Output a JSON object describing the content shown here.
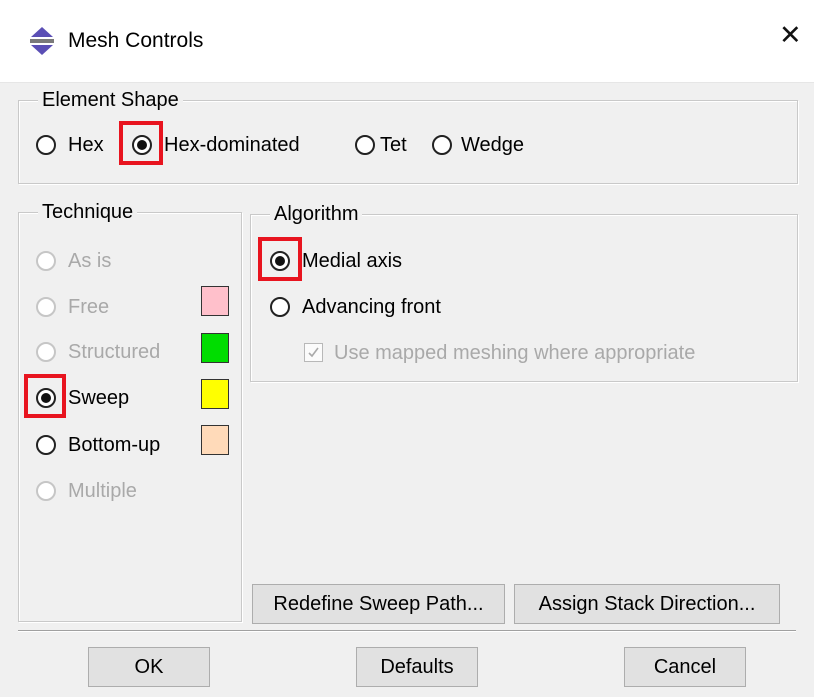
{
  "dialog": {
    "title": "Mesh Controls",
    "close_glyph": "✕",
    "app_icon": "abaqus-mesh-icon"
  },
  "element_shape": {
    "legend": "Element Shape",
    "options": [
      {
        "label": "Hex",
        "selected": false
      },
      {
        "label": "Hex-dominated",
        "selected": true
      },
      {
        "label": "Tet",
        "selected": false
      },
      {
        "label": "Wedge",
        "selected": false
      }
    ]
  },
  "technique": {
    "legend": "Technique",
    "options": [
      {
        "label": "As is",
        "selected": false,
        "enabled": false,
        "swatch": null
      },
      {
        "label": "Free",
        "selected": false,
        "enabled": false,
        "swatch": "#ffc0cb"
      },
      {
        "label": "Structured",
        "selected": false,
        "enabled": false,
        "swatch": "#00dd00"
      },
      {
        "label": "Sweep",
        "selected": true,
        "enabled": true,
        "swatch": "#ffff00"
      },
      {
        "label": "Bottom-up",
        "selected": false,
        "enabled": true,
        "swatch": "#ffdab9"
      },
      {
        "label": "Multiple",
        "selected": false,
        "enabled": false,
        "swatch": null
      }
    ]
  },
  "algorithm": {
    "legend": "Algorithm",
    "options": [
      {
        "label": "Medial axis",
        "selected": true
      },
      {
        "label": "Advancing front",
        "selected": false
      }
    ],
    "mapped_meshing": {
      "label": "Use mapped meshing where appropriate",
      "checked": true,
      "enabled": false
    }
  },
  "actions": {
    "redefine_sweep_path": "Redefine Sweep Path...",
    "assign_stack_direction": "Assign Stack Direction..."
  },
  "footer": {
    "ok": "OK",
    "defaults": "Defaults",
    "cancel": "Cancel"
  },
  "colors": {
    "highlight": "#e8141f",
    "background": "#f0f0f0"
  }
}
